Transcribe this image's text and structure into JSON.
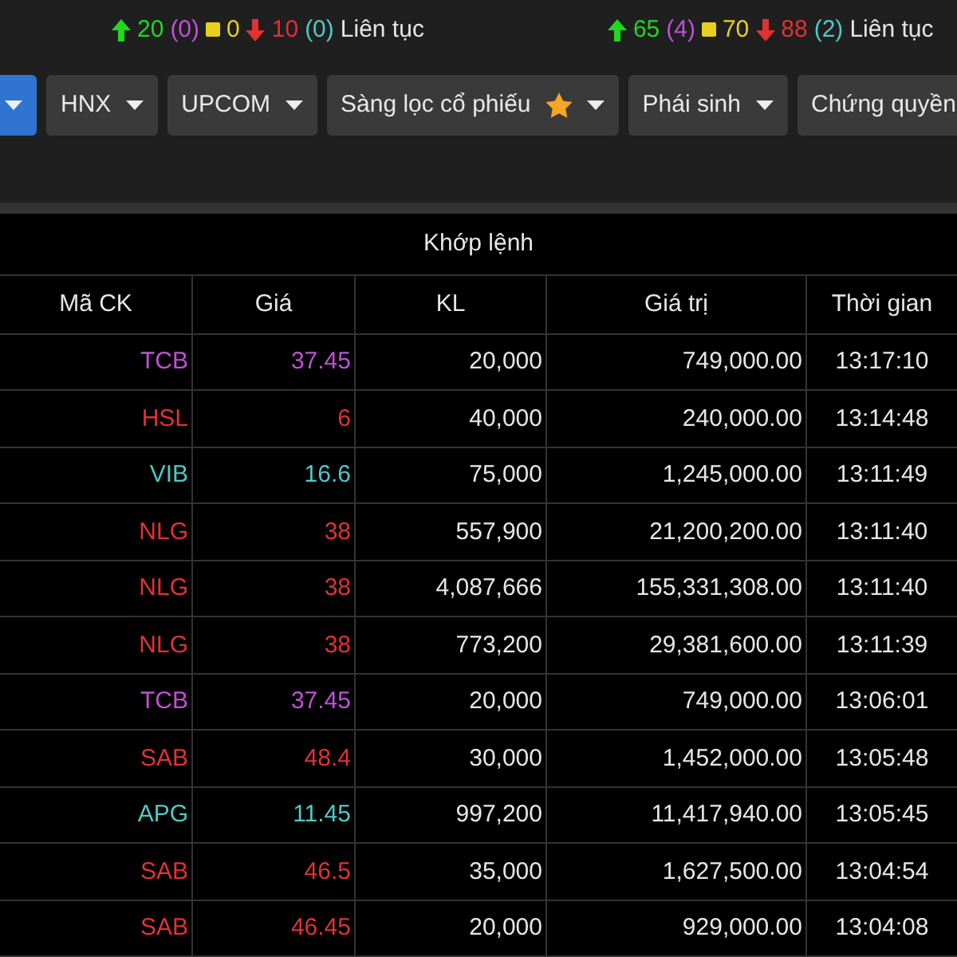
{
  "summaries": [
    {
      "counts": [
        {
          "kind": "up",
          "text": "20"
        },
        {
          "kind": "ceiling",
          "text": "(0)"
        },
        {
          "kind": "unchanged",
          "text": "0"
        },
        {
          "kind": "down",
          "text": "10"
        },
        {
          "kind": "floor",
          "text": "(0)"
        }
      ],
      "session": "Liên tục"
    },
    {
      "counts": [
        {
          "kind": "up",
          "text": "65"
        },
        {
          "kind": "ceiling",
          "text": "(4)"
        },
        {
          "kind": "unchanged",
          "text": "70"
        },
        {
          "kind": "down",
          "text": "88"
        },
        {
          "kind": "floor",
          "text": "(2)"
        }
      ],
      "session": "Liên tục"
    }
  ],
  "tabs": [
    {
      "selected": true,
      "caret": true,
      "star": false
    },
    {
      "label": "HNX",
      "selected": false,
      "caret": true,
      "star": false
    },
    {
      "label": "UPCOM",
      "selected": false,
      "caret": true,
      "star": false
    },
    {
      "label": "Sàng lọc cổ phiếu",
      "selected": false,
      "caret": true,
      "star": true
    },
    {
      "label": "Phái sinh",
      "selected": false,
      "caret": true,
      "star": false
    },
    {
      "label": "Chứng quyền",
      "selected": false,
      "caret": false,
      "star": false
    }
  ],
  "table": {
    "title": "Khớp lệnh",
    "columns": [
      "Mã CK",
      "Giá",
      "KL",
      "Giá trị",
      "Thời gian"
    ],
    "rows": [
      {
        "symbol": "TCB",
        "price": "37.45",
        "volume": "20,000",
        "value": "749,000.00",
        "time": "13:17:10",
        "color": "#c050d8"
      },
      {
        "symbol": "HSL",
        "price": "6",
        "volume": "40,000",
        "value": "240,000.00",
        "time": "13:14:48",
        "color": "#e03232"
      },
      {
        "symbol": "VIB",
        "price": "16.6",
        "volume": "75,000",
        "value": "1,245,000.00",
        "time": "13:11:49",
        "color": "#50c8c8"
      },
      {
        "symbol": "NLG",
        "price": "38",
        "volume": "557,900",
        "value": "21,200,200.00",
        "time": "13:11:40",
        "color": "#e03232"
      },
      {
        "symbol": "NLG",
        "price": "38",
        "volume": "4,087,666",
        "value": "155,331,308.00",
        "time": "13:11:40",
        "color": "#e03232"
      },
      {
        "symbol": "NLG",
        "price": "38",
        "volume": "773,200",
        "value": "29,381,600.00",
        "time": "13:11:39",
        "color": "#e03232"
      },
      {
        "symbol": "TCB",
        "price": "37.45",
        "volume": "20,000",
        "value": "749,000.00",
        "time": "13:06:01",
        "color": "#c050d8"
      },
      {
        "symbol": "SAB",
        "price": "48.4",
        "volume": "30,000",
        "value": "1,452,000.00",
        "time": "13:05:48",
        "color": "#e03232"
      },
      {
        "symbol": "APG",
        "price": "11.45",
        "volume": "997,200",
        "value": "11,417,940.00",
        "time": "13:05:45",
        "color": "#50c8c8"
      },
      {
        "symbol": "SAB",
        "price": "46.5",
        "volume": "35,000",
        "value": "1,627,500.00",
        "time": "13:04:54",
        "color": "#e03232"
      },
      {
        "symbol": "SAB",
        "price": "46.45",
        "volume": "20,000",
        "value": "929,000.00",
        "time": "13:04:08",
        "color": "#e03232"
      }
    ]
  }
}
